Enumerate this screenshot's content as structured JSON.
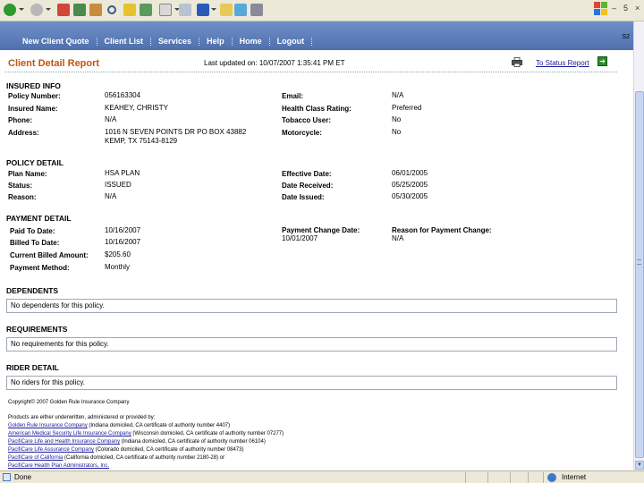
{
  "browser": {
    "corner_label": "S2",
    "minimize": "–",
    "restore": "5",
    "close": "×"
  },
  "nav": {
    "items": [
      "New Client Quote",
      "Client List",
      "Services",
      "Help",
      "Home",
      "Logout"
    ]
  },
  "header": {
    "title": "Client Detail Report",
    "updated": "Last updated on: 10/07/2007 1:35:41 PM ET",
    "status_link": "To Status Report",
    "go_glyph": "➔"
  },
  "insured": {
    "title": "INSURED INFO",
    "policy_number_label": "Policy Number:",
    "policy_number": "056163304",
    "insured_name_label": "Insured Name:",
    "insured_name": "KEAHEY, CHRISTY",
    "phone_label": "Phone:",
    "phone": "N/A",
    "address_label": "Address:",
    "address_line1": "1016 N SEVEN POINTS DR PO BOX 43882",
    "address_line2": "KEMP, TX 75143-8129",
    "email_label": "Email:",
    "email": "N/A",
    "health_label": "Health Class Rating:",
    "health": "Preferred",
    "tobacco_label": "Tobacco User:",
    "tobacco": "No",
    "motorcycle_label": "Motorcycle:",
    "motorcycle": "No"
  },
  "policy": {
    "title": "POLICY DETAIL",
    "plan_label": "Plan Name:",
    "plan": "HSA PLAN",
    "status_label": "Status:",
    "status": "ISSUED",
    "reason_label": "Reason:",
    "reason": "N/A",
    "effective_label": "Effective Date:",
    "effective": "06/01/2005",
    "received_label": "Date Received:",
    "received": "05/25/2005",
    "issued_label": "Date Issued:",
    "issued": "05/30/2005"
  },
  "payment": {
    "title": "PAYMENT DETAIL",
    "paid_label": "Paid To Date:",
    "paid": "10/16/2007",
    "billed_label": "Billed To Date:",
    "billed": "10/16/2007",
    "amount_label": "Current Billed Amount:",
    "amount": "$205.60",
    "method_label": "Payment Method:",
    "method": "Monthly",
    "change_date_label": "Payment Change Date:",
    "change_date": "10/01/2007",
    "change_reason_label": "Reason for Payment Change:",
    "change_reason": "N/A"
  },
  "dependents": {
    "title": "DEPENDENTS",
    "text": "No dependents for this policy."
  },
  "requirements": {
    "title": "REQUIREMENTS",
    "text": "No requirements for this policy."
  },
  "riders": {
    "title": "RIDER DETAIL",
    "text": "No riders for this policy."
  },
  "footer": {
    "copyright": "Copyright© 2007 Golden Rule Insurance Company",
    "intro": "Products are either underwritten, administered or provided by:",
    "line1_link": "Golden Rule Insurance Company",
    "line1_rest": " (Indiana domiciled, CA certificate of authority number 4407)",
    "line2_link": "American Medical Security Life Insurance Company",
    "line2_rest": " (Wisconsin domiciled, CA certificate of authority number 07277)",
    "line3_link": "PacifiCare Life and Health Insurance Company",
    "line3_rest": " (Indiana domiciled, CA certificate of authority number 06104)",
    "line4_link": "PacifiCare Life Assurance Company",
    "line4_rest": " (Colorado domiciled, CA certificate of authority number 08473)",
    "line5_link": "PacifiCare of California",
    "line5_rest": " (California domiciled, CA certificate of authority number 2180-28) or",
    "line6_link": "PacifiCare Health Plan Administrators, Inc."
  },
  "statusbar": {
    "done": "Done",
    "zone": "Internet"
  },
  "colors": {
    "title_orange": "#c2560e",
    "nav_blue": "#4f70ad",
    "link_blue": "#1a1a9a"
  }
}
